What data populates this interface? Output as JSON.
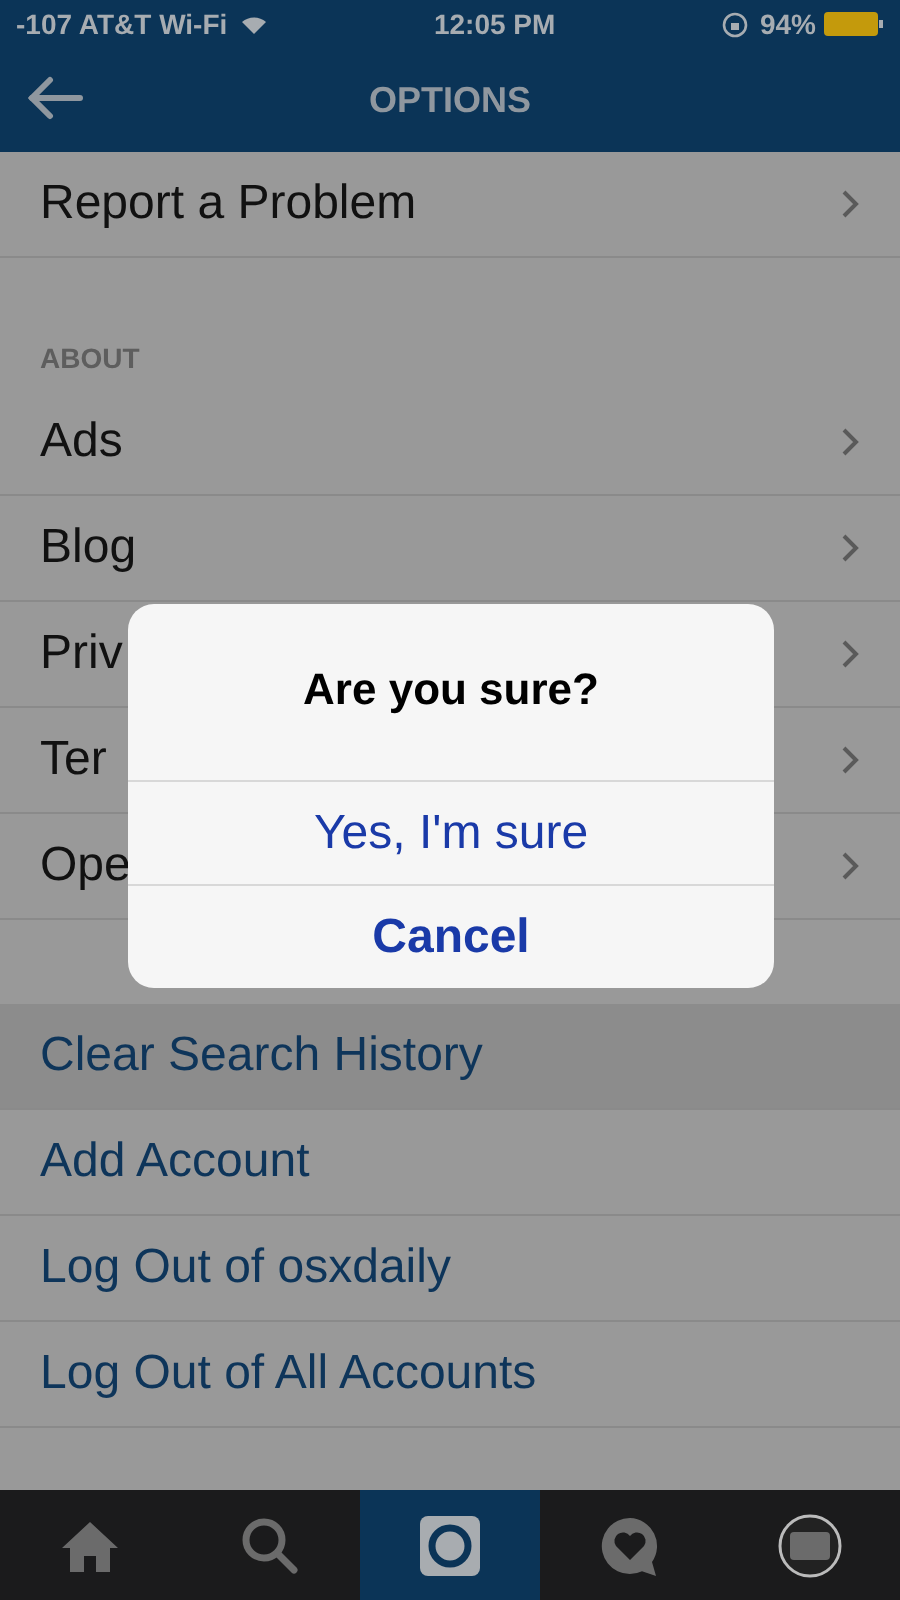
{
  "status_bar": {
    "carrier": "-107 AT&T Wi-Fi",
    "time": "12:05 PM",
    "battery": "94%"
  },
  "nav_bar": {
    "title": "OPTIONS"
  },
  "sections": [
    {
      "rows": [
        {
          "label": "Report a Problem",
          "kind": "nav",
          "selected": false
        }
      ]
    },
    {
      "header": "ABOUT",
      "rows": [
        {
          "label": "Ads",
          "kind": "nav",
          "selected": false
        },
        {
          "label": "Blog",
          "kind": "nav",
          "selected": false
        },
        {
          "label": "Priv",
          "kind": "nav",
          "selected": false
        },
        {
          "label": "Ter",
          "kind": "nav",
          "selected": false
        },
        {
          "label": "Ope",
          "kind": "nav",
          "selected": false
        }
      ]
    },
    {
      "rows": [
        {
          "label": "Clear Search History",
          "kind": "action",
          "selected": true
        },
        {
          "label": "Add Account",
          "kind": "action",
          "selected": false
        },
        {
          "label": "Log Out of osxdaily",
          "kind": "action",
          "selected": false
        },
        {
          "label": "Log Out of All Accounts",
          "kind": "action",
          "selected": false
        }
      ]
    }
  ],
  "dialog": {
    "title": "Are you sure?",
    "buttons": [
      {
        "label": "Yes, I'm sure",
        "kind": "default"
      },
      {
        "label": "Cancel",
        "kind": "cancel"
      }
    ]
  },
  "tab_bar": [
    {
      "kind": "home",
      "selected": false
    },
    {
      "kind": "search",
      "selected": false
    },
    {
      "kind": "camera",
      "selected": true
    },
    {
      "kind": "activity",
      "selected": false
    },
    {
      "kind": "profile",
      "selected": false
    }
  ]
}
